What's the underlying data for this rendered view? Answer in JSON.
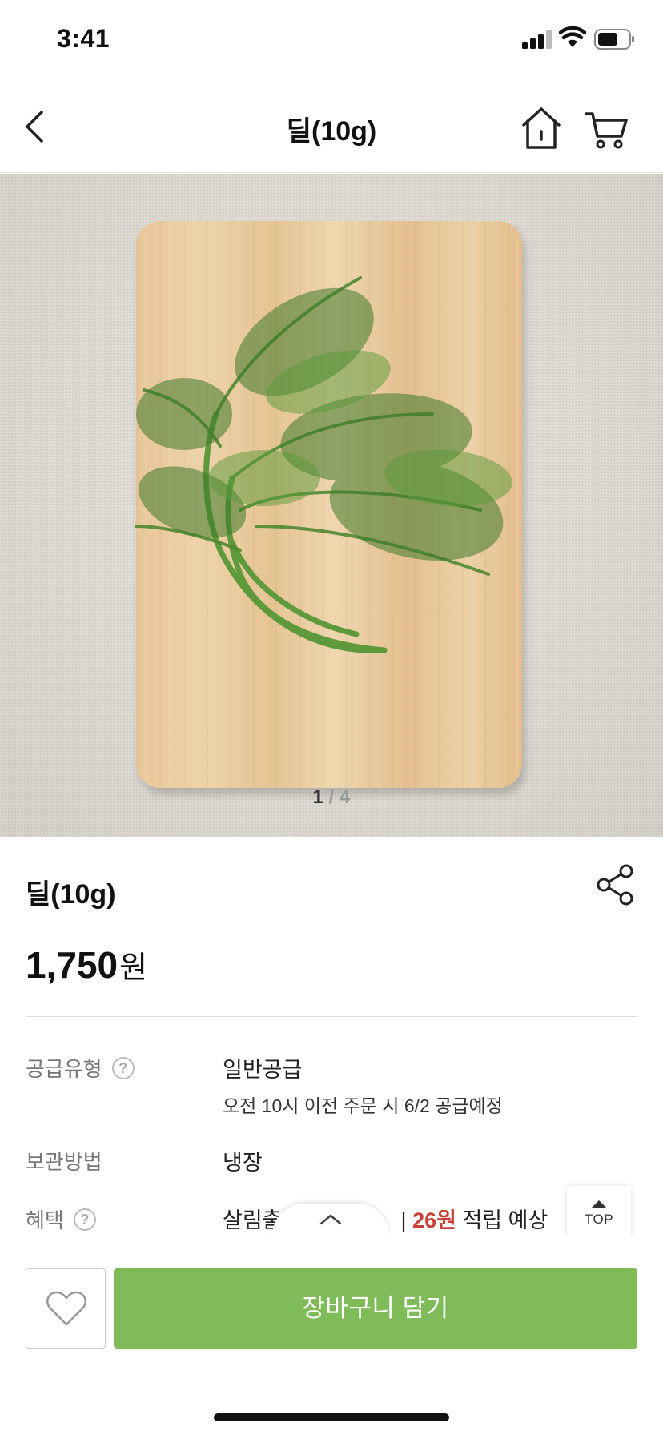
{
  "status_bar": {
    "time": "3:41"
  },
  "header": {
    "title": "딜(10g)",
    "cart_count": "0"
  },
  "gallery": {
    "current": "1",
    "separator": "/",
    "total": "4"
  },
  "product": {
    "name": "딜(10g)",
    "price": "1,750",
    "currency": "원"
  },
  "details": {
    "supply_type": {
      "label": "공급유형",
      "value": "일반공급",
      "note": "오전 10시 이전 주문 시 6/2 공급예정"
    },
    "storage": {
      "label": "보관방법",
      "value": "냉장"
    },
    "benefit": {
      "label": "혜택",
      "prefix": "살림출",
      "amount": "26원",
      "suffix": "적립 예상",
      "divider": "|"
    }
  },
  "top_button": {
    "label": "TOP"
  },
  "actions": {
    "add_to_cart": "장바구니 담기"
  },
  "colors": {
    "accent": "#7fbb58",
    "badge": "#7ab85a",
    "highlight": "#c9423a"
  }
}
